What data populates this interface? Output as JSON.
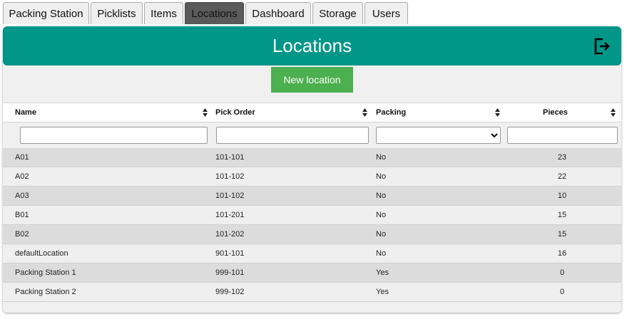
{
  "tabs": [
    {
      "label": "Packing Station",
      "active": false
    },
    {
      "label": "Picklists",
      "active": false
    },
    {
      "label": "Items",
      "active": false
    },
    {
      "label": "Locations",
      "active": true
    },
    {
      "label": "Dashboard",
      "active": false
    },
    {
      "label": "Storage",
      "active": false
    },
    {
      "label": "Users",
      "active": false
    }
  ],
  "header": {
    "title": "Locations",
    "logout_icon": "logout-icon",
    "color": "#009688"
  },
  "toolbar": {
    "new_label": "New location",
    "new_color": "#4caf50"
  },
  "table": {
    "columns": [
      "Name",
      "Pick Order",
      "Packing",
      "Pieces"
    ],
    "filters": {
      "name": "",
      "pick_order": "",
      "packing": "",
      "pieces": ""
    },
    "rows": [
      {
        "name": "A01",
        "pick_order": "101-101",
        "packing": "No",
        "pieces": "23"
      },
      {
        "name": "A02",
        "pick_order": "101-102",
        "packing": "No",
        "pieces": "22"
      },
      {
        "name": "A03",
        "pick_order": "101-102",
        "packing": "No",
        "pieces": "10"
      },
      {
        "name": "B01",
        "pick_order": "101-201",
        "packing": "No",
        "pieces": "15"
      },
      {
        "name": "B02",
        "pick_order": "101-202",
        "packing": "No",
        "pieces": "15"
      },
      {
        "name": "defaultLocation",
        "pick_order": "901-101",
        "packing": "No",
        "pieces": "16"
      },
      {
        "name": "Packing Station 1",
        "pick_order": "999-101",
        "packing": "Yes",
        "pieces": "0"
      },
      {
        "name": "Packing Station 2",
        "pick_order": "999-102",
        "packing": "Yes",
        "pieces": "0"
      }
    ]
  }
}
